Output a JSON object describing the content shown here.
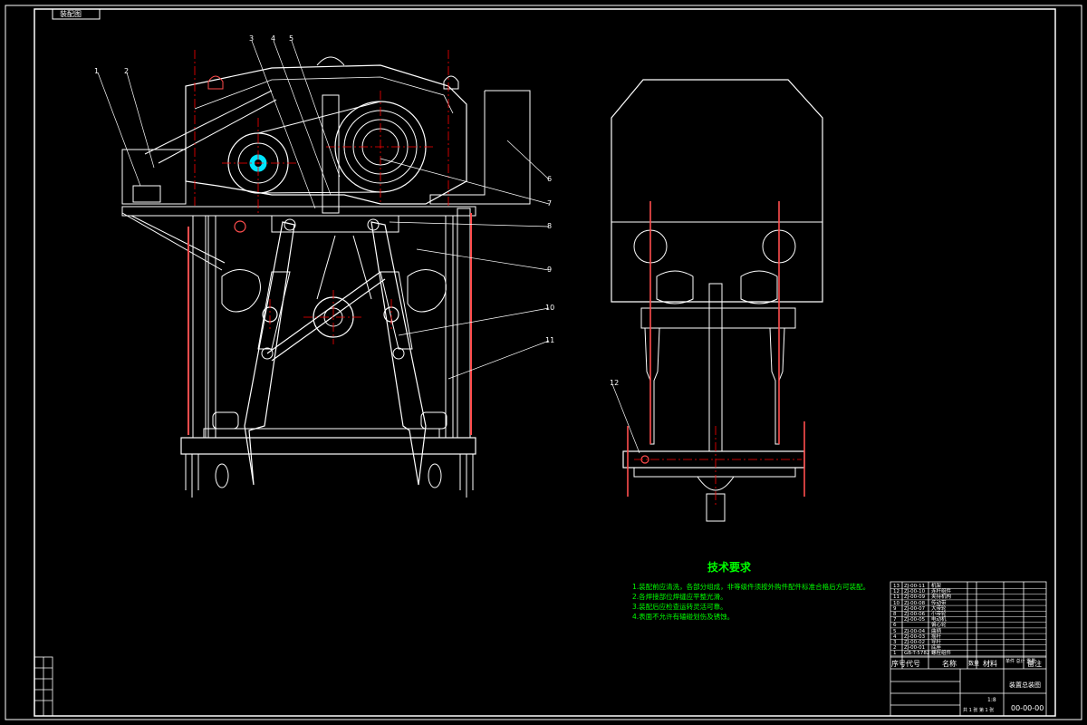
{
  "drawing": {
    "corner_label": "装配图",
    "tech_requirements": {
      "title": "技术要求",
      "items": [
        "1.装配前应清洗，各部分组成，非等级件须按外购件配件标准合格后方可装配。",
        "2.各焊接部位焊缝应平整光滑。",
        "3.装配后应检查运转灵活可靠。",
        "4.表面不允许有磕碰划伤及锈蚀。"
      ]
    },
    "title_block": {
      "drawing_name": "装置总装图",
      "drawing_no": "00-00-00",
      "scale": "1:8",
      "sheet": "共 1 张 第 1 张"
    },
    "bom_header": {
      "seq": "序号",
      "code": "代号",
      "name": "名称",
      "qty": "数量",
      "material": "材料",
      "weight": "单件 总计 重量",
      "note": "备注"
    },
    "bom_rows": [
      {
        "code": "ZJ-00-11",
        "name": "机架"
      },
      {
        "code": "ZJ-00-10",
        "name": "连杆组件"
      },
      {
        "code": "ZJ-00-09",
        "name": "夹持机构"
      },
      {
        "code": "ZJ-00-08",
        "name": "传动带"
      },
      {
        "code": "ZJ-00-07",
        "name": "大带轮"
      },
      {
        "code": "ZJ-00-06",
        "name": "小带轮"
      },
      {
        "code": "ZJ-00-05",
        "name": "电动机"
      },
      {
        "code": "",
        "name": "偏心轮"
      },
      {
        "code": "ZJ-00-04",
        "name": "曲柄"
      },
      {
        "code": "ZJ-00-03",
        "name": "摇杆"
      },
      {
        "code": "ZJ-00-02",
        "name": "导杆"
      },
      {
        "code": "ZJ-00-01",
        "name": "底座"
      },
      {
        "code": "GB-T-5782",
        "name": "螺栓组件"
      }
    ],
    "callouts": [
      "1",
      "2",
      "3",
      "4",
      "5",
      "6",
      "7",
      "8",
      "9",
      "10",
      "11",
      "12"
    ],
    "colors": {
      "outline": "#ffffff",
      "center_line": "#ff0000",
      "part": "#ff4d4d",
      "note_text": "#00ff00",
      "hub": "#00e5ff"
    }
  }
}
